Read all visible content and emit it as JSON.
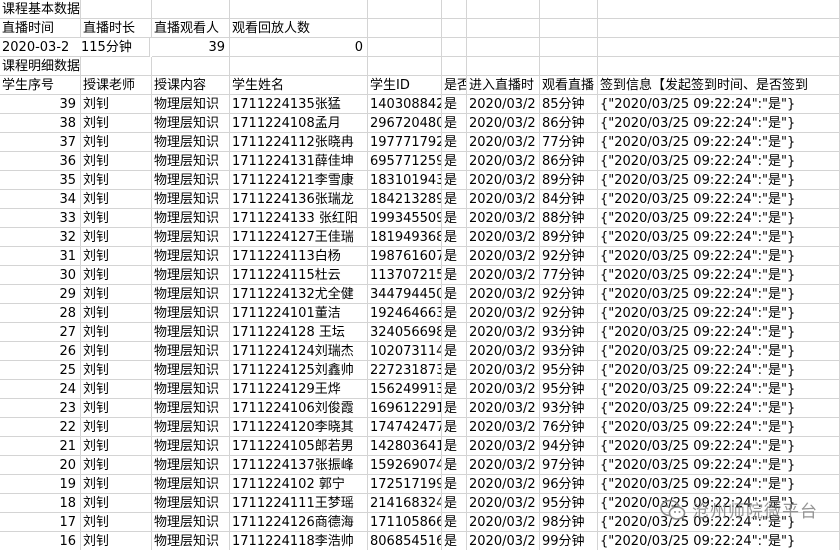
{
  "summary": {
    "section_title": "课程基本数据",
    "headers": [
      "直播时间",
      "直播时长",
      "直播观看人",
      "观看回放人数"
    ],
    "values": [
      "2020-03-2",
      "115分钟",
      "39",
      "0"
    ]
  },
  "detail": {
    "section_title": "课程明细数据",
    "headers": [
      "学生序号",
      "授课老师",
      "授课内容",
      "学生姓名",
      "学生ID",
      "是否",
      "进入直播时",
      "观看直播",
      "签到信息【发起签到时间、是否签到"
    ],
    "rows": [
      [
        "39",
        "刘钊",
        "物理层知识",
        "1711224135张猛",
        "140308842",
        "是",
        "2020/03/2",
        "85分钟",
        "{\"2020/03/25 09:22:24\":\"是\"}"
      ],
      [
        "38",
        "刘钊",
        "物理层知识",
        "1711224108孟月",
        "296720480",
        "是",
        "2020/03/2",
        "86分钟",
        "{\"2020/03/25 09:22:24\":\"是\"}"
      ],
      [
        "37",
        "刘钊",
        "物理层知识",
        "1711224112张晓冉",
        "197771792",
        "是",
        "2020/03/2",
        "77分钟",
        "{\"2020/03/25 09:22:24\":\"是\"}"
      ],
      [
        "36",
        "刘钊",
        "物理层知识",
        "1711224131薛佳坤",
        "695771259",
        "是",
        "2020/03/2",
        "86分钟",
        "{\"2020/03/25 09:22:24\":\"是\"}"
      ],
      [
        "35",
        "刘钊",
        "物理层知识",
        "1711224121李雪康",
        "183101943",
        "是",
        "2020/03/2",
        "89分钟",
        "{\"2020/03/25 09:22:24\":\"是\"}"
      ],
      [
        "34",
        "刘钊",
        "物理层知识",
        "1711224136张瑞龙",
        "184213289",
        "是",
        "2020/03/2",
        "84分钟",
        "{\"2020/03/25 09:22:24\":\"是\"}"
      ],
      [
        "33",
        "刘钊",
        "物理层知识",
        "1711224133 张红阳",
        "199345509",
        "是",
        "2020/03/2",
        "88分钟",
        "{\"2020/03/25 09:22:24\":\"是\"}"
      ],
      [
        "32",
        "刘钊",
        "物理层知识",
        "1711224127王佳瑞",
        "181949368",
        "是",
        "2020/03/2",
        "89分钟",
        "{\"2020/03/25 09:22:24\":\"是\"}"
      ],
      [
        "31",
        "刘钊",
        "物理层知识",
        "1711224113白杨",
        "198761607",
        "是",
        "2020/03/2",
        "92分钟",
        "{\"2020/03/25 09:22:24\":\"是\"}"
      ],
      [
        "30",
        "刘钊",
        "物理层知识",
        "1711224115杜云",
        "113707215",
        "是",
        "2020/03/2",
        "77分钟",
        "{\"2020/03/25 09:22:24\":\"是\"}"
      ],
      [
        "29",
        "刘钊",
        "物理层知识",
        "1711224132尤全健",
        "344794450",
        "是",
        "2020/03/2",
        "92分钟",
        "{\"2020/03/25 09:22:24\":\"是\"}"
      ],
      [
        "28",
        "刘钊",
        "物理层知识",
        "1711224101董洁",
        "192464663",
        "是",
        "2020/03/2",
        "92分钟",
        "{\"2020/03/25 09:22:24\":\"是\"}"
      ],
      [
        "27",
        "刘钊",
        "物理层知识",
        "1711224128 王坛",
        "324056698",
        "是",
        "2020/03/2",
        "93分钟",
        "{\"2020/03/25 09:22:24\":\"是\"}"
      ],
      [
        "26",
        "刘钊",
        "物理层知识",
        "1711224124刘瑞杰",
        "102073114",
        "是",
        "2020/03/2",
        "93分钟",
        "{\"2020/03/25 09:22:24\":\"是\"}"
      ],
      [
        "25",
        "刘钊",
        "物理层知识",
        "1711224125刘鑫帅",
        "227231873",
        "是",
        "2020/03/2",
        "95分钟",
        "{\"2020/03/25 09:22:24\":\"是\"}"
      ],
      [
        "24",
        "刘钊",
        "物理层知识",
        "1711224129王烨",
        "156249913",
        "是",
        "2020/03/2",
        "95分钟",
        "{\"2020/03/25 09:22:24\":\"是\"}"
      ],
      [
        "23",
        "刘钊",
        "物理层知识",
        "1711224106刘俊霞",
        "169612291",
        "是",
        "2020/03/2",
        "93分钟",
        "{\"2020/03/25 09:22:24\":\"是\"}"
      ],
      [
        "22",
        "刘钊",
        "物理层知识",
        "1711224120李晓其",
        "174742477",
        "是",
        "2020/03/2",
        "76分钟",
        "{\"2020/03/25 09:22:24\":\"是\"}"
      ],
      [
        "21",
        "刘钊",
        "物理层知识",
        "1711224105郎若男",
        "142803641",
        "是",
        "2020/03/2",
        "94分钟",
        "{\"2020/03/25 09:22:24\":\"是\"}"
      ],
      [
        "20",
        "刘钊",
        "物理层知识",
        "1711224137张振峰",
        "159269074",
        "是",
        "2020/03/2",
        "97分钟",
        "{\"2020/03/25 09:22:24\":\"是\"}"
      ],
      [
        "19",
        "刘钊",
        "物理层知识",
        "1711224102  郭宁",
        "172517199",
        "是",
        "2020/03/2",
        "96分钟",
        "{\"2020/03/25 09:22:24\":\"是\"}"
      ],
      [
        "18",
        "刘钊",
        "物理层知识",
        "1711224111王梦瑶",
        "214168324",
        "是",
        "2020/03/2",
        "95分钟",
        "{\"2020/03/25 09:22:24\":\"是\"}"
      ],
      [
        "17",
        "刘钊",
        "物理层知识",
        "1711224126商德海",
        "171105866",
        "是",
        "2020/03/2",
        "98分钟",
        "{\"2020/03/25 09:22:24\":\"是\"}"
      ],
      [
        "16",
        "刘钊",
        "物理层知识",
        "1711224118李浩帅",
        "806854516",
        "是",
        "2020/03/2",
        "99分钟",
        "{\"2020/03/25 09:22:24\":\"是\"}"
      ]
    ]
  },
  "watermark": {
    "text": "沧州师院微平台",
    "icon": "wechat-logo-icon",
    "color": "#8a8a8a"
  },
  "colors": {
    "gridline": "#d4d4d4",
    "edge_marker": "#21a366"
  }
}
